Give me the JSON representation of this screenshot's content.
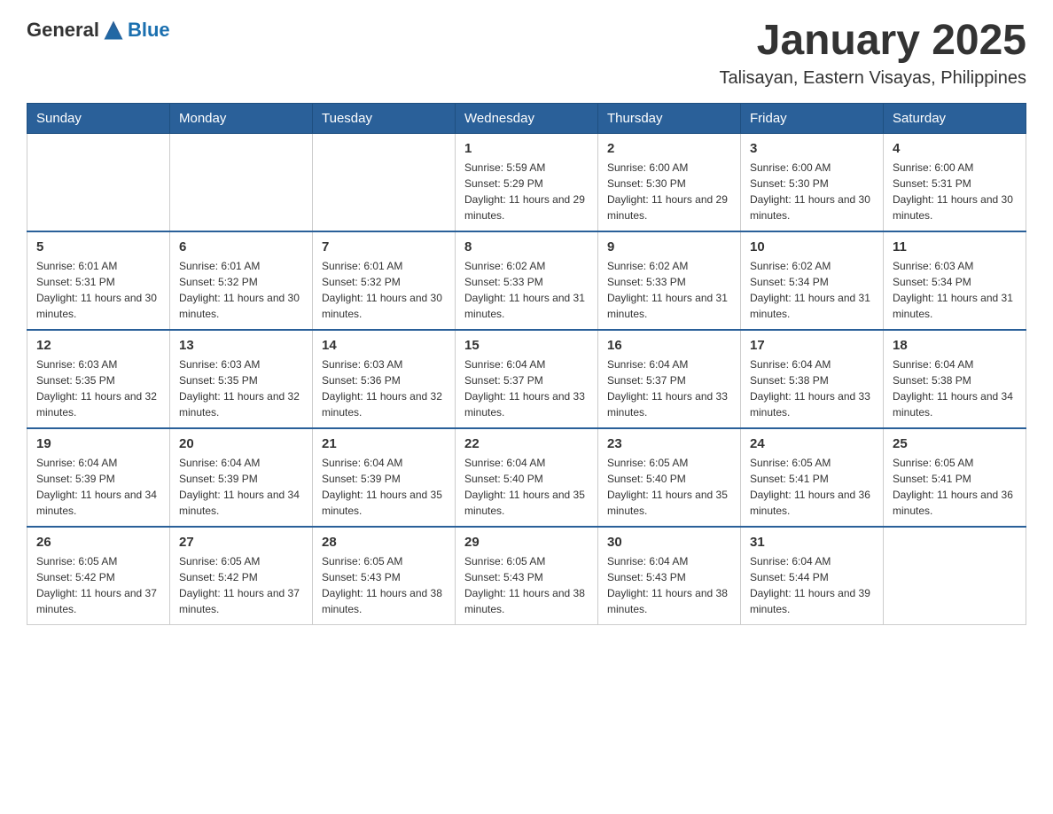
{
  "header": {
    "logo_text_general": "General",
    "logo_text_blue": "Blue",
    "month_title": "January 2025",
    "location": "Talisayan, Eastern Visayas, Philippines"
  },
  "days_of_week": [
    "Sunday",
    "Monday",
    "Tuesday",
    "Wednesday",
    "Thursday",
    "Friday",
    "Saturday"
  ],
  "weeks": [
    [
      {
        "day": "",
        "info": ""
      },
      {
        "day": "",
        "info": ""
      },
      {
        "day": "",
        "info": ""
      },
      {
        "day": "1",
        "info": "Sunrise: 5:59 AM\nSunset: 5:29 PM\nDaylight: 11 hours and 29 minutes."
      },
      {
        "day": "2",
        "info": "Sunrise: 6:00 AM\nSunset: 5:30 PM\nDaylight: 11 hours and 29 minutes."
      },
      {
        "day": "3",
        "info": "Sunrise: 6:00 AM\nSunset: 5:30 PM\nDaylight: 11 hours and 30 minutes."
      },
      {
        "day": "4",
        "info": "Sunrise: 6:00 AM\nSunset: 5:31 PM\nDaylight: 11 hours and 30 minutes."
      }
    ],
    [
      {
        "day": "5",
        "info": "Sunrise: 6:01 AM\nSunset: 5:31 PM\nDaylight: 11 hours and 30 minutes."
      },
      {
        "day": "6",
        "info": "Sunrise: 6:01 AM\nSunset: 5:32 PM\nDaylight: 11 hours and 30 minutes."
      },
      {
        "day": "7",
        "info": "Sunrise: 6:01 AM\nSunset: 5:32 PM\nDaylight: 11 hours and 30 minutes."
      },
      {
        "day": "8",
        "info": "Sunrise: 6:02 AM\nSunset: 5:33 PM\nDaylight: 11 hours and 31 minutes."
      },
      {
        "day": "9",
        "info": "Sunrise: 6:02 AM\nSunset: 5:33 PM\nDaylight: 11 hours and 31 minutes."
      },
      {
        "day": "10",
        "info": "Sunrise: 6:02 AM\nSunset: 5:34 PM\nDaylight: 11 hours and 31 minutes."
      },
      {
        "day": "11",
        "info": "Sunrise: 6:03 AM\nSunset: 5:34 PM\nDaylight: 11 hours and 31 minutes."
      }
    ],
    [
      {
        "day": "12",
        "info": "Sunrise: 6:03 AM\nSunset: 5:35 PM\nDaylight: 11 hours and 32 minutes."
      },
      {
        "day": "13",
        "info": "Sunrise: 6:03 AM\nSunset: 5:35 PM\nDaylight: 11 hours and 32 minutes."
      },
      {
        "day": "14",
        "info": "Sunrise: 6:03 AM\nSunset: 5:36 PM\nDaylight: 11 hours and 32 minutes."
      },
      {
        "day": "15",
        "info": "Sunrise: 6:04 AM\nSunset: 5:37 PM\nDaylight: 11 hours and 33 minutes."
      },
      {
        "day": "16",
        "info": "Sunrise: 6:04 AM\nSunset: 5:37 PM\nDaylight: 11 hours and 33 minutes."
      },
      {
        "day": "17",
        "info": "Sunrise: 6:04 AM\nSunset: 5:38 PM\nDaylight: 11 hours and 33 minutes."
      },
      {
        "day": "18",
        "info": "Sunrise: 6:04 AM\nSunset: 5:38 PM\nDaylight: 11 hours and 34 minutes."
      }
    ],
    [
      {
        "day": "19",
        "info": "Sunrise: 6:04 AM\nSunset: 5:39 PM\nDaylight: 11 hours and 34 minutes."
      },
      {
        "day": "20",
        "info": "Sunrise: 6:04 AM\nSunset: 5:39 PM\nDaylight: 11 hours and 34 minutes."
      },
      {
        "day": "21",
        "info": "Sunrise: 6:04 AM\nSunset: 5:39 PM\nDaylight: 11 hours and 35 minutes."
      },
      {
        "day": "22",
        "info": "Sunrise: 6:04 AM\nSunset: 5:40 PM\nDaylight: 11 hours and 35 minutes."
      },
      {
        "day": "23",
        "info": "Sunrise: 6:05 AM\nSunset: 5:40 PM\nDaylight: 11 hours and 35 minutes."
      },
      {
        "day": "24",
        "info": "Sunrise: 6:05 AM\nSunset: 5:41 PM\nDaylight: 11 hours and 36 minutes."
      },
      {
        "day": "25",
        "info": "Sunrise: 6:05 AM\nSunset: 5:41 PM\nDaylight: 11 hours and 36 minutes."
      }
    ],
    [
      {
        "day": "26",
        "info": "Sunrise: 6:05 AM\nSunset: 5:42 PM\nDaylight: 11 hours and 37 minutes."
      },
      {
        "day": "27",
        "info": "Sunrise: 6:05 AM\nSunset: 5:42 PM\nDaylight: 11 hours and 37 minutes."
      },
      {
        "day": "28",
        "info": "Sunrise: 6:05 AM\nSunset: 5:43 PM\nDaylight: 11 hours and 38 minutes."
      },
      {
        "day": "29",
        "info": "Sunrise: 6:05 AM\nSunset: 5:43 PM\nDaylight: 11 hours and 38 minutes."
      },
      {
        "day": "30",
        "info": "Sunrise: 6:04 AM\nSunset: 5:43 PM\nDaylight: 11 hours and 38 minutes."
      },
      {
        "day": "31",
        "info": "Sunrise: 6:04 AM\nSunset: 5:44 PM\nDaylight: 11 hours and 39 minutes."
      },
      {
        "day": "",
        "info": ""
      }
    ]
  ]
}
